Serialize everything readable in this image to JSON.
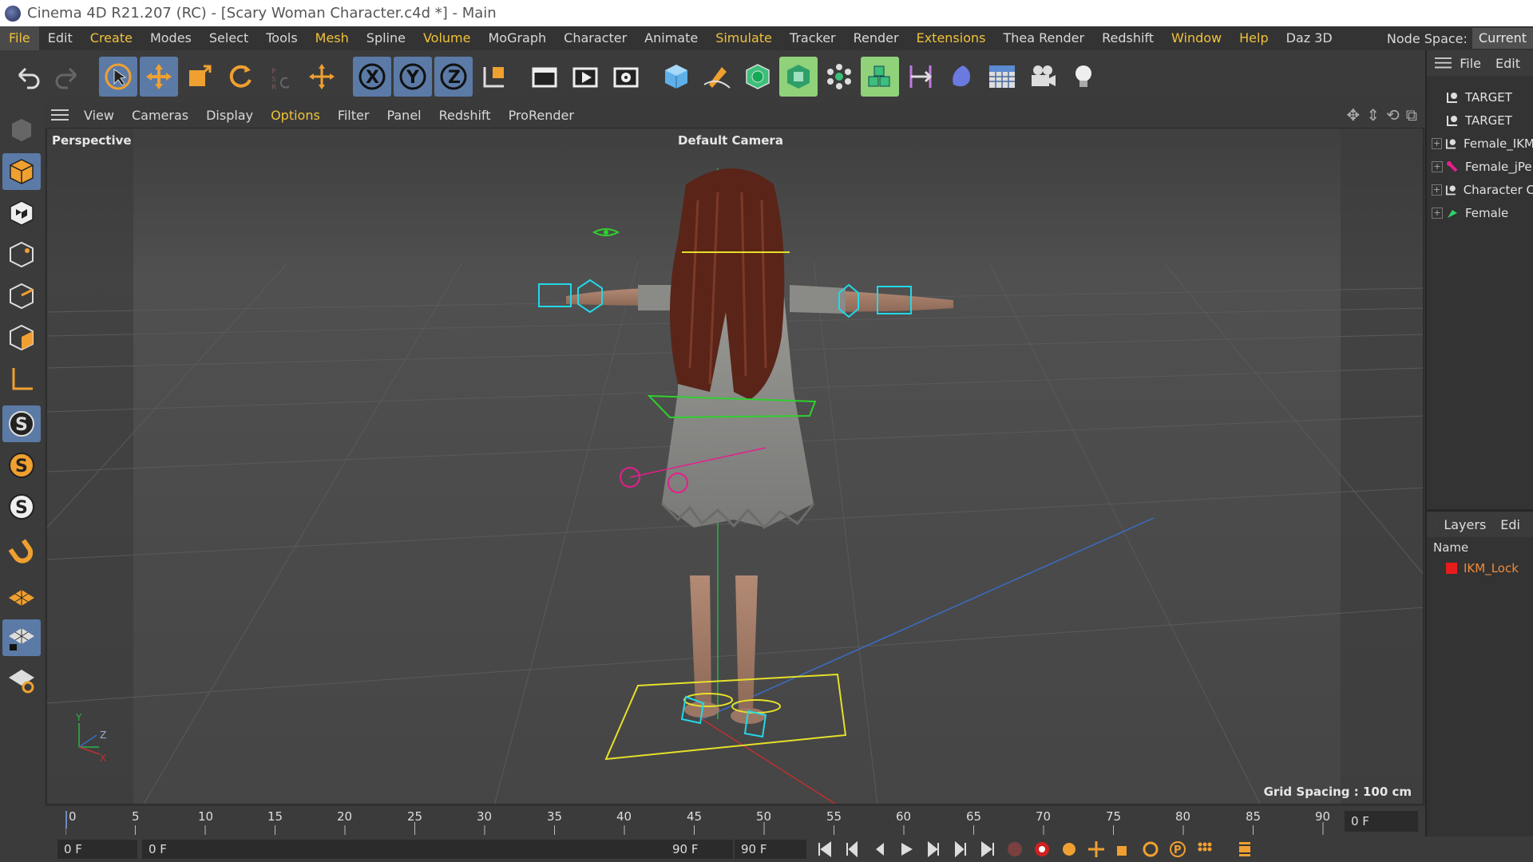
{
  "window": {
    "title": "Cinema 4D R21.207 (RC) - [Scary Woman Character.c4d *] - Main"
  },
  "menubar": {
    "items": [
      "File",
      "Edit",
      "Create",
      "Modes",
      "Select",
      "Tools",
      "Mesh",
      "Spline",
      "Volume",
      "MoGraph",
      "Character",
      "Animate",
      "Simulate",
      "Tracker",
      "Render",
      "Extensions",
      "Thea Render",
      "Redshift",
      "Window",
      "Help",
      "Daz 3D"
    ],
    "node_space_label": "Node Space:",
    "node_space_value": "Current"
  },
  "toolbar": {
    "icons": [
      "undo-icon",
      "redo-icon",
      "live-selection-icon",
      "move-icon",
      "scale-icon",
      "rotate-icon",
      "psr-lock-icon",
      "coordinate-icon",
      "x-axis-icon",
      "y-axis-icon",
      "z-axis-icon",
      "world-coordinates-icon",
      "render-region-icon",
      "render-view-icon",
      "render-settings-icon",
      "cube-icon",
      "pen-icon",
      "subdivision-icon",
      "extrude-icon",
      "cloner-icon",
      "voronoi-icon",
      "bend-icon",
      "deformer-icon",
      "floor-icon",
      "camera-icon",
      "light-icon"
    ]
  },
  "viewport": {
    "menus": [
      "View",
      "Cameras",
      "Display",
      "Options",
      "Filter",
      "Panel",
      "Redshift",
      "ProRender"
    ],
    "label": "Perspective",
    "camera": "Default Camera",
    "grid_spacing": "Grid Spacing : 100 cm",
    "axis_y": "Y",
    "axis_z": "Z",
    "axis_x": "X"
  },
  "timeline": {
    "ticks": [
      "0",
      "5",
      "10",
      "15",
      "20",
      "25",
      "30",
      "35",
      "40",
      "45",
      "50",
      "55",
      "60",
      "65",
      "70",
      "75",
      "80",
      "85",
      "90"
    ],
    "current_frame": "0 F"
  },
  "transport": {
    "start": "0 F",
    "range_start": "0 F",
    "range_end": "90 F",
    "end": "90 F"
  },
  "objects_panel": {
    "menu": [
      "File",
      "Edit"
    ],
    "items": [
      {
        "name": "TARGET",
        "expandable": false,
        "icon": "null-icon"
      },
      {
        "name": "TARGET",
        "expandable": false,
        "icon": "null-icon"
      },
      {
        "name": "Female_IKM",
        "expandable": true,
        "icon": "null-icon"
      },
      {
        "name": "Female_jPe",
        "expandable": true,
        "icon": "joint-icon"
      },
      {
        "name": "Character C",
        "expandable": true,
        "icon": "null-icon"
      },
      {
        "name": "Female",
        "expandable": true,
        "icon": "polygon-object-icon"
      }
    ]
  },
  "layers_panel": {
    "menu": [
      "Layers",
      "Edi"
    ],
    "column": "Name",
    "items": [
      {
        "name": "IKM_Lock",
        "color": "#e81c1c"
      }
    ]
  },
  "colors": {
    "accent": "#f0c23a",
    "selected": "#5b7aa6",
    "viewport_bg": "#4a4a4a"
  }
}
